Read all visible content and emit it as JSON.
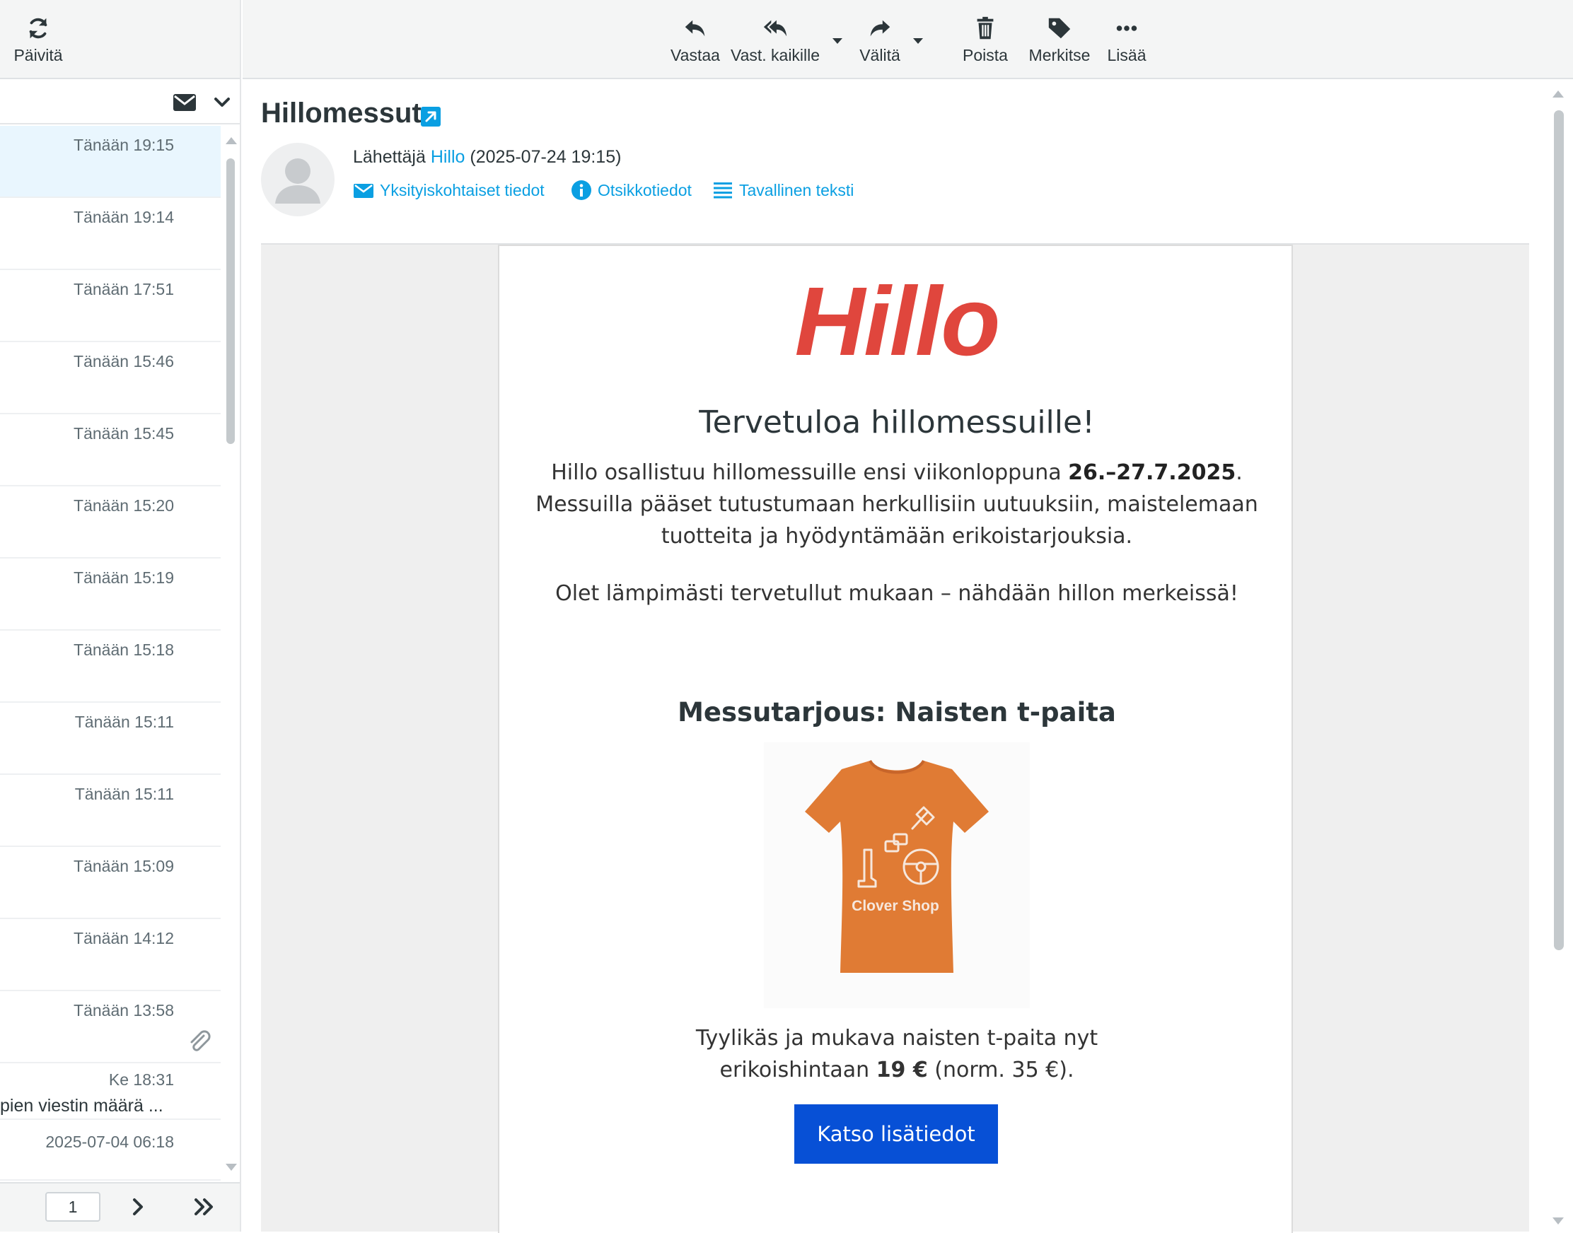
{
  "left_toolbar": {
    "refresh_label": "Päivitä"
  },
  "message_list": {
    "rows": [
      {
        "time": "Tänään 19:15",
        "subject": ""
      },
      {
        "time": "Tänään 19:14",
        "subject": ""
      },
      {
        "time": "Tänään 17:51",
        "subject": ""
      },
      {
        "time": "Tänään 15:46",
        "subject": ""
      },
      {
        "time": "Tänään 15:45",
        "subject": ""
      },
      {
        "time": "Tänään 15:20",
        "subject": ""
      },
      {
        "time": "Tänään 15:19",
        "subject": ""
      },
      {
        "time": "Tänään 15:18",
        "subject": ""
      },
      {
        "time": "Tänään 15:11",
        "subject": ""
      },
      {
        "time": "Tänään 15:11",
        "subject": ""
      },
      {
        "time": "Tänään 15:09",
        "subject": ""
      },
      {
        "time": "Tänään 14:12",
        "subject": ""
      },
      {
        "time": "Tänään 13:58",
        "subject": ""
      },
      {
        "time": "Ke 18:31",
        "subject": "pien viestin määrä ..."
      },
      {
        "time": "2025-07-04 06:18",
        "subject": ""
      }
    ]
  },
  "pager": {
    "page": "1"
  },
  "toolbar": {
    "reply": "Vastaa",
    "reply_all": "Vast. kaikille",
    "forward": "Välitä",
    "delete": "Poista",
    "mark": "Merkitse",
    "more": "Lisää"
  },
  "message": {
    "subject": "Hillomessut",
    "sender_prefix": "Lähettäjä",
    "sender_name": "Hillo",
    "sender_date": "(2025-07-24 19:15)",
    "links": {
      "privacy": "Yksityiskohtaiset tiedot",
      "headers": "Otsikkotiedot",
      "plain": "Tavallinen teksti"
    }
  },
  "email": {
    "logo": "Hillo",
    "welcome": "Tervetuloa hillomessuille!",
    "intro_1": "Hillo osallistuu hillomessuille ensi viikonloppuna ",
    "intro_dates": "26.–27.7.2025",
    "intro_2": ". Messuilla pääset tutustumaan herkullisiin uutuuksiin, maistelemaan tuotteita ja hyödyntämään erikoistarjouksia.",
    "welcome2": "Olet lämpimästi tervetullut mukaan – nähdään hillon merkeissä!",
    "offer_title": "Messutarjous: Naisten t-paita",
    "shirt_print": "Clover Shop",
    "offer_desc_1": "Tyylikäs ja mukava naisten t-paita nyt",
    "offer_desc_2": "erikoishintaan ",
    "offer_price": "19 €",
    "offer_desc_3": " (norm. 35 €).",
    "cta": "Katso lisätiedot"
  },
  "colors": {
    "accent": "#0a9fe2",
    "logo": "#e0463d",
    "cta": "#0750d6",
    "selected_row": "#e9f6fe",
    "shirt": "#e07b34"
  }
}
